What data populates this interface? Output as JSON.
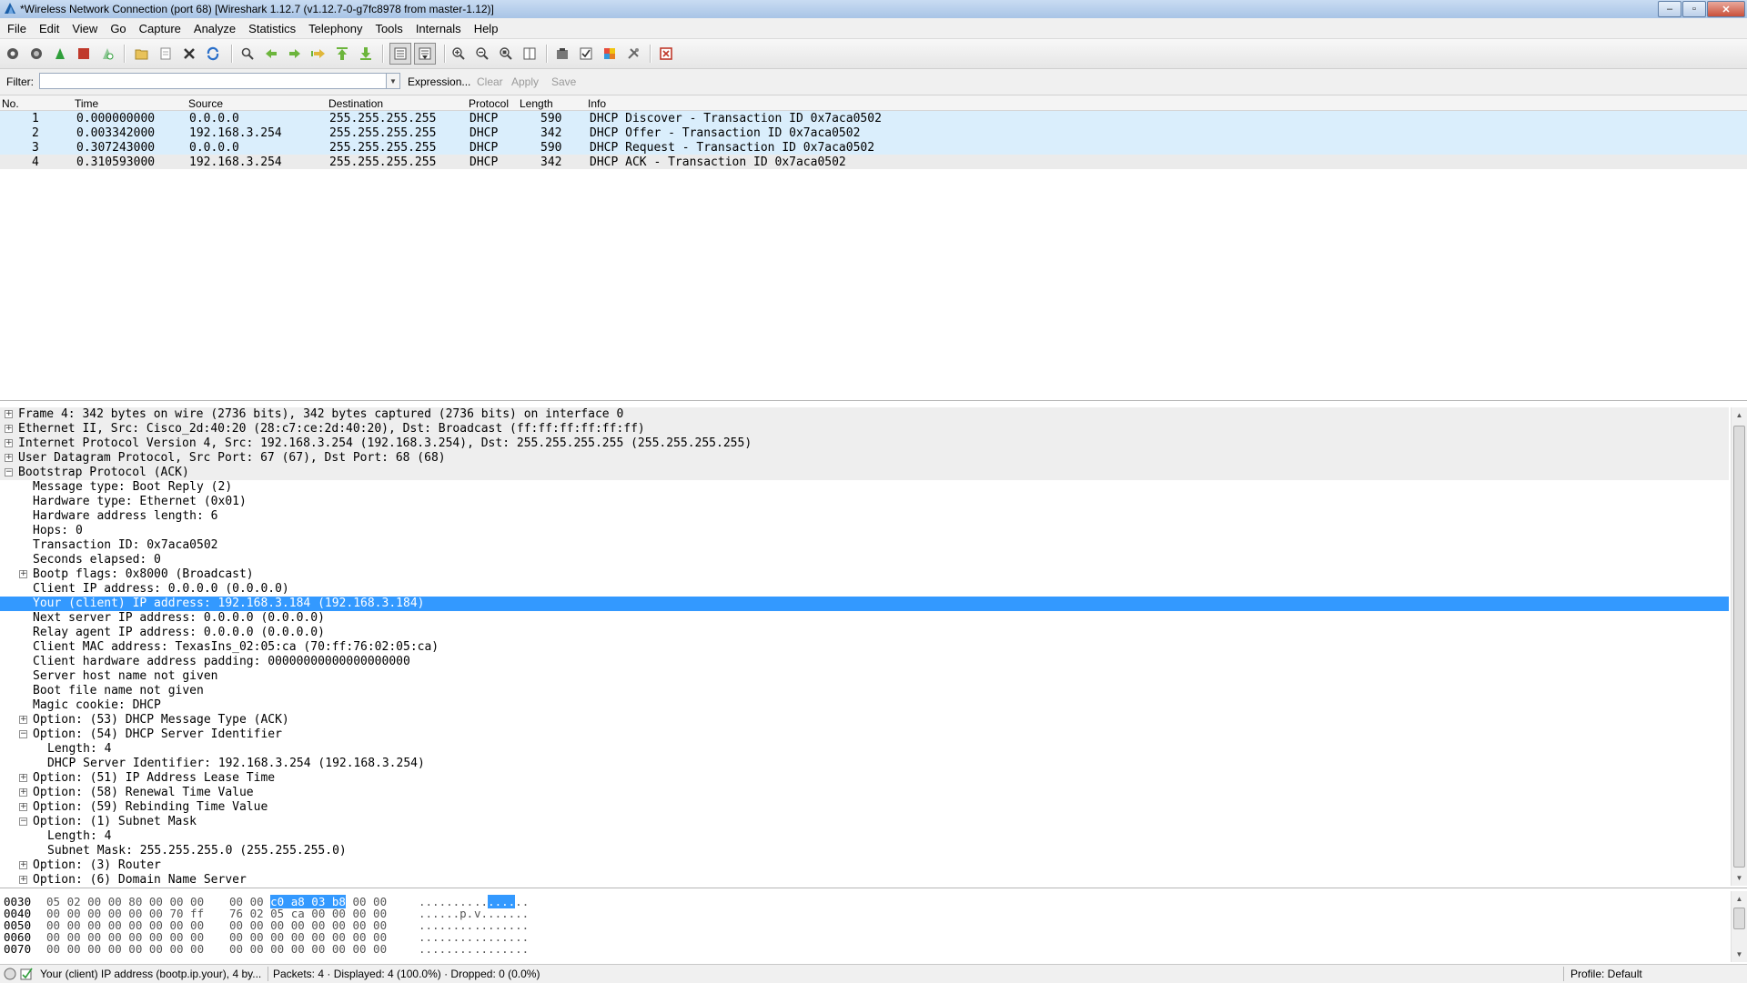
{
  "window": {
    "title": "*Wireless Network Connection (port 68)   [Wireshark 1.12.7  (v1.12.7-0-g7fc8978 from master-1.12)]"
  },
  "menu": [
    "File",
    "Edit",
    "View",
    "Go",
    "Capture",
    "Analyze",
    "Statistics",
    "Telephony",
    "Tools",
    "Internals",
    "Help"
  ],
  "filter": {
    "label": "Filter:",
    "value": "",
    "expression_label": "Expression...",
    "clear_label": "Clear",
    "apply_label": "Apply",
    "save_label": "Save"
  },
  "packet_list": {
    "columns": [
      "No.",
      "Time",
      "Source",
      "Destination",
      "Protocol",
      "Length",
      "Info"
    ],
    "rows": [
      {
        "no": "1",
        "time": "0.000000000",
        "source": "0.0.0.0",
        "destination": "255.255.255.255",
        "protocol": "DHCP",
        "length": "590",
        "info": "DHCP Discover - Transaction ID 0x7aca0502"
      },
      {
        "no": "2",
        "time": "0.003342000",
        "source": "192.168.3.254",
        "destination": "255.255.255.255",
        "protocol": "DHCP",
        "length": "342",
        "info": "DHCP Offer    - Transaction ID 0x7aca0502"
      },
      {
        "no": "3",
        "time": "0.307243000",
        "source": "0.0.0.0",
        "destination": "255.255.255.255",
        "protocol": "DHCP",
        "length": "590",
        "info": "DHCP Request  - Transaction ID 0x7aca0502"
      },
      {
        "no": "4",
        "time": "0.310593000",
        "source": "192.168.3.254",
        "destination": "255.255.255.255",
        "protocol": "DHCP",
        "length": "342",
        "info": "DHCP ACK      - Transaction ID 0x7aca0502"
      }
    ]
  },
  "details": [
    {
      "text": "Frame 4: 342 bytes on wire (2736 bits), 342 bytes captured (2736 bits) on interface 0",
      "level": 0,
      "expander": "+",
      "kind": "top"
    },
    {
      "text": "Ethernet II, Src: Cisco_2d:40:20 (28:c7:ce:2d:40:20), Dst: Broadcast (ff:ff:ff:ff:ff:ff)",
      "level": 0,
      "expander": "+",
      "kind": "top"
    },
    {
      "text": "Internet Protocol Version 4, Src: 192.168.3.254 (192.168.3.254), Dst: 255.255.255.255 (255.255.255.255)",
      "level": 0,
      "expander": "+",
      "kind": "top"
    },
    {
      "text": "User Datagram Protocol, Src Port: 67 (67), Dst Port: 68 (68)",
      "level": 0,
      "expander": "+",
      "kind": "top"
    },
    {
      "text": "Bootstrap Protocol (ACK)",
      "level": 0,
      "expander": "-",
      "kind": "top"
    },
    {
      "text": "Message type: Boot Reply (2)",
      "level": 1,
      "expander": "",
      "kind": ""
    },
    {
      "text": "Hardware type: Ethernet (0x01)",
      "level": 1,
      "expander": "",
      "kind": ""
    },
    {
      "text": "Hardware address length: 6",
      "level": 1,
      "expander": "",
      "kind": ""
    },
    {
      "text": "Hops: 0",
      "level": 1,
      "expander": "",
      "kind": ""
    },
    {
      "text": "Transaction ID: 0x7aca0502",
      "level": 1,
      "expander": "",
      "kind": ""
    },
    {
      "text": "Seconds elapsed: 0",
      "level": 1,
      "expander": "",
      "kind": ""
    },
    {
      "text": "Bootp flags: 0x8000 (Broadcast)",
      "level": 1,
      "expander": "+",
      "kind": ""
    },
    {
      "text": "Client IP address: 0.0.0.0 (0.0.0.0)",
      "level": 1,
      "expander": "",
      "kind": ""
    },
    {
      "text": "Your (client) IP address: 192.168.3.184 (192.168.3.184)",
      "level": 1,
      "expander": "",
      "kind": "sel"
    },
    {
      "text": "Next server IP address: 0.0.0.0 (0.0.0.0)",
      "level": 1,
      "expander": "",
      "kind": ""
    },
    {
      "text": "Relay agent IP address: 0.0.0.0 (0.0.0.0)",
      "level": 1,
      "expander": "",
      "kind": ""
    },
    {
      "text": "Client MAC address: TexasIns_02:05:ca (70:ff:76:02:05:ca)",
      "level": 1,
      "expander": "",
      "kind": ""
    },
    {
      "text": "Client hardware address padding: 00000000000000000000",
      "level": 1,
      "expander": "",
      "kind": ""
    },
    {
      "text": "Server host name not given",
      "level": 1,
      "expander": "",
      "kind": ""
    },
    {
      "text": "Boot file name not given",
      "level": 1,
      "expander": "",
      "kind": ""
    },
    {
      "text": "Magic cookie: DHCP",
      "level": 1,
      "expander": "",
      "kind": ""
    },
    {
      "text": "Option: (53) DHCP Message Type (ACK)",
      "level": 1,
      "expander": "+",
      "kind": ""
    },
    {
      "text": "Option: (54) DHCP Server Identifier",
      "level": 1,
      "expander": "-",
      "kind": ""
    },
    {
      "text": "Length: 4",
      "level": 2,
      "expander": "",
      "kind": ""
    },
    {
      "text": "DHCP Server Identifier: 192.168.3.254 (192.168.3.254)",
      "level": 2,
      "expander": "",
      "kind": ""
    },
    {
      "text": "Option: (51) IP Address Lease Time",
      "level": 1,
      "expander": "+",
      "kind": ""
    },
    {
      "text": "Option: (58) Renewal Time Value",
      "level": 1,
      "expander": "+",
      "kind": ""
    },
    {
      "text": "Option: (59) Rebinding Time Value",
      "level": 1,
      "expander": "+",
      "kind": ""
    },
    {
      "text": "Option: (1) Subnet Mask",
      "level": 1,
      "expander": "-",
      "kind": ""
    },
    {
      "text": "Length: 4",
      "level": 2,
      "expander": "",
      "kind": ""
    },
    {
      "text": "Subnet Mask: 255.255.255.0 (255.255.255.0)",
      "level": 2,
      "expander": "",
      "kind": ""
    },
    {
      "text": "Option: (3) Router",
      "level": 1,
      "expander": "+",
      "kind": ""
    },
    {
      "text": "Option: (6) Domain Name Server",
      "level": 1,
      "expander": "+",
      "kind": ""
    }
  ],
  "bytes": [
    {
      "offset": "0030",
      "hex1": "05 02 00 00 80 00 00 00",
      "hex2_plain": "00 00 ",
      "hex2_hl": "c0 a8 03 b8",
      "hex2_rest": " 00 00",
      "ascii1": "........",
      "ascii2_plain": " ..",
      "ascii2_hl": "....",
      "ascii2_rest": ".."
    },
    {
      "offset": "0040",
      "hex1": "00 00 00 00 00 00 70 ff",
      "hex2_plain": "76 02 05 ca 00 00 00 00",
      "hex2_hl": "",
      "hex2_rest": "",
      "ascii1": "......p.",
      "ascii2_plain": " v.......",
      "ascii2_hl": "",
      "ascii2_rest": ""
    },
    {
      "offset": "0050",
      "hex1": "00 00 00 00 00 00 00 00",
      "hex2_plain": "00 00 00 00 00 00 00 00",
      "hex2_hl": "",
      "hex2_rest": "",
      "ascii1": "........",
      "ascii2_plain": " ........",
      "ascii2_hl": "",
      "ascii2_rest": ""
    },
    {
      "offset": "0060",
      "hex1": "00 00 00 00 00 00 00 00",
      "hex2_plain": "00 00 00 00 00 00 00 00",
      "hex2_hl": "",
      "hex2_rest": "",
      "ascii1": "........",
      "ascii2_plain": " ........",
      "ascii2_hl": "",
      "ascii2_rest": ""
    },
    {
      "offset": "0070",
      "hex1": "00 00 00 00 00 00 00 00",
      "hex2_plain": "00 00 00 00 00 00 00 00",
      "hex2_hl": "",
      "hex2_rest": "",
      "ascii1": "........",
      "ascii2_plain": " ........",
      "ascii2_hl": "",
      "ascii2_rest": ""
    }
  ],
  "status": {
    "field_info": "Your (client) IP address (bootp.ip.your), 4 by...",
    "packets": "Packets: 4 · Displayed: 4 (100.0%) · Dropped: 0 (0.0%)",
    "profile": "Profile: Default"
  },
  "colors": {
    "selection": "#3399ff",
    "row_alt": "#daeefc"
  }
}
